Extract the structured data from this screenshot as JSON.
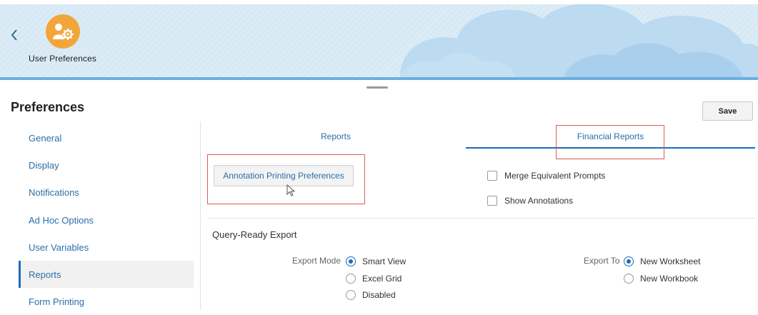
{
  "header": {
    "app_title": "User Preferences",
    "back_icon": "chevron-left-icon",
    "app_icon": "user-settings-icon",
    "accent_color": "#f2a63a"
  },
  "page": {
    "title": "Preferences",
    "save_label": "Save"
  },
  "sidebar": {
    "items": [
      {
        "label": "General"
      },
      {
        "label": "Display"
      },
      {
        "label": "Notifications"
      },
      {
        "label": "Ad Hoc Options"
      },
      {
        "label": "User Variables"
      },
      {
        "label": "Reports",
        "active": true
      },
      {
        "label": "Form Printing"
      }
    ]
  },
  "tabs": [
    {
      "label": "Reports"
    },
    {
      "label": "Financial Reports",
      "active": true
    }
  ],
  "reports": {
    "annotation_button": "Annotation Printing Preferences",
    "checkboxes": [
      {
        "label": "Merge Equivalent Prompts",
        "checked": false
      },
      {
        "label": "Show Annotations",
        "checked": false
      }
    ]
  },
  "query_ready_export": {
    "title": "Query-Ready Export",
    "export_mode": {
      "label": "Export Mode",
      "options": [
        {
          "label": "Smart View",
          "selected": true
        },
        {
          "label": "Excel Grid",
          "selected": false
        },
        {
          "label": "Disabled",
          "selected": false
        }
      ]
    },
    "export_to": {
      "label": "Export To",
      "options": [
        {
          "label": "New Worksheet",
          "selected": true
        },
        {
          "label": "New Workbook",
          "selected": false
        }
      ]
    }
  }
}
